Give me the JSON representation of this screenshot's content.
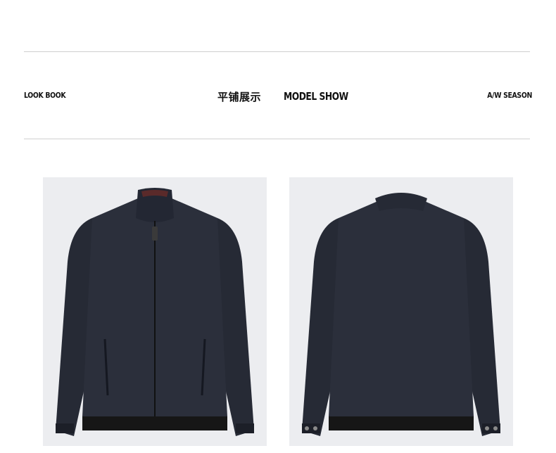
{
  "header": {
    "left_label": "LOOK BOOK",
    "center_title_cn": "平铺展示",
    "center_title_en": "MODEL SHOW",
    "right_label": "A/W SEASON"
  },
  "gallery": {
    "photos": [
      {
        "view": "front",
        "subject": "navy-stand-collar-zip-jacket"
      },
      {
        "view": "back",
        "subject": "navy-stand-collar-zip-jacket"
      }
    ]
  },
  "colors": {
    "jacket_navy": "#2b2f3b",
    "rib_trim": "#161616",
    "photo_background": "#ecedf0",
    "rule": "#cfcfcf"
  }
}
